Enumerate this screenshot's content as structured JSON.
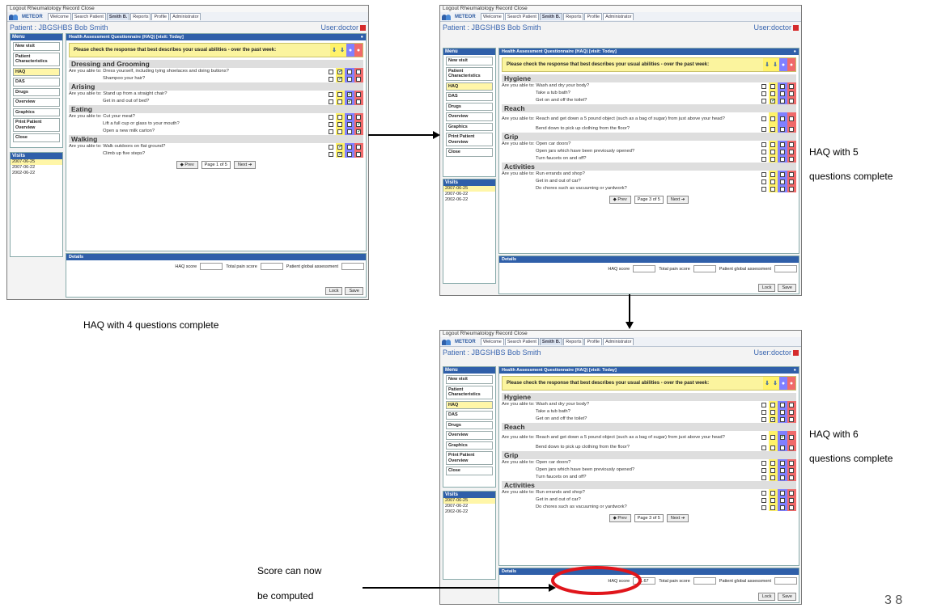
{
  "app": {
    "topbar": "Logout  Rheumatology Record  Close",
    "logo": "METEOR",
    "tabs": [
      "Welcome",
      "Search Patient",
      "Smith B.",
      "Reports",
      "Profile",
      "Administrator"
    ],
    "patient": "Patient : JBGSHBS Bob Smith",
    "user": "User:doctor",
    "menu_header": "Menu",
    "menu_items": [
      "New visit",
      "Patient Characteristics",
      "HAQ",
      "DAS",
      "Drugs",
      "Overview",
      "Graphics",
      "Print Patient Overview",
      "Close"
    ],
    "visits_header": "Visits",
    "visits": [
      "2007-06-25",
      "2007-06-22",
      "2002-06-22"
    ],
    "main_header": "Health Assessment Questionnaire (HAQ) [visit: Today]",
    "instruction": "Please check the response that best describes your usual abilities - over the past week:",
    "details_header": "Details",
    "haq_score_label": "HAQ score",
    "pain_label": "Total pain score",
    "global_label": "Patient global assessment",
    "prev": "Prev",
    "next": "Next",
    "lock": "Lock",
    "save": "Save",
    "colors": {
      "yellow": "#fff26a",
      "purple": "#8080ff",
      "red": "#f06a6a",
      "header": "#2f5fa9"
    }
  },
  "screen1": {
    "page": "Page 1 of 5",
    "haq_score": "",
    "sections": [
      {
        "title": "Dressing and Grooming",
        "questions": [
          {
            "text": "Are you able to: Dress yourself, including tying shoelaces and doing buttons?",
            "checked": 1
          },
          {
            "text": "Shampoo your hair?",
            "checked": 1,
            "sub": true
          }
        ]
      },
      {
        "title": "Arising",
        "questions": [
          {
            "text": "Are you able to: Stand up from a straight chair?",
            "checked": 2
          },
          {
            "text": "Get in and out of bed?",
            "checked": 2,
            "sub": true
          }
        ]
      },
      {
        "title": "Eating",
        "questions": [
          {
            "text": "Are you able to: Cut your meat?",
            "checked": -1
          },
          {
            "text": "Lift a full cup or glass to your mouth?",
            "checked": 3,
            "sub": true
          },
          {
            "text": "Open a new milk carton?",
            "checked": 3,
            "sub": true
          }
        ]
      },
      {
        "title": "Walking",
        "questions": [
          {
            "text": "Are you able to: Walk outdoors on flat ground?",
            "checked": 1
          },
          {
            "text": "Climb up five steps?",
            "checked": 1,
            "sub": true
          }
        ]
      }
    ]
  },
  "screen2": {
    "page": "Page 3 of 5",
    "haq_score": "",
    "sections": [
      {
        "title": "Hygiene",
        "questions": [
          {
            "text": "Are you able to: Wash and dry your body?",
            "checked": -1
          },
          {
            "text": "Take a tub bath?",
            "checked": -1,
            "sub": true
          },
          {
            "text": "Get on and off the toilet?",
            "checked": 1,
            "sub": true
          }
        ]
      },
      {
        "title": "Reach",
        "questions": [
          {
            "text": "Are you able to: Reach and get down a 5 pound object (such as a bag of sugar) from just above your head?",
            "checked": -1,
            "tall": true
          },
          {
            "text": "Bend down to pick up clothing from the floor?",
            "checked": -1,
            "sub": true
          }
        ]
      },
      {
        "title": "Grip",
        "questions": [
          {
            "text": "Are you able to: Open car doors?",
            "checked": -1
          },
          {
            "text": "Open jars which have been previously opened?",
            "checked": -1,
            "sub": true
          },
          {
            "text": "Turn faucets on and off?",
            "checked": -1,
            "sub": true
          }
        ]
      },
      {
        "title": "Activities",
        "questions": [
          {
            "text": "Are you able to: Run errands and shop?",
            "checked": -1
          },
          {
            "text": "Get in and out of car?",
            "checked": -1,
            "sub": true
          },
          {
            "text": "Do chores such as vacuuming or yardwork?",
            "checked": -1,
            "sub": true
          }
        ]
      }
    ]
  },
  "screen3": {
    "page": "Page 3 of 5",
    "haq_score": "1.67",
    "sections": [
      {
        "title": "Hygiene",
        "questions": [
          {
            "text": "Are you able to: Wash and dry your body?",
            "checked": -1
          },
          {
            "text": "Take a tub bath?",
            "checked": -1,
            "sub": true
          },
          {
            "text": "Get on and off the toilet?",
            "checked": 1,
            "sub": true
          }
        ]
      },
      {
        "title": "Reach",
        "questions": [
          {
            "text": "Are you able to: Reach and get down a 5 pound object (such as a bag of sugar) from just above your head?",
            "checked": 2,
            "tall": true
          },
          {
            "text": "Bend down to pick up clothing from the floor?",
            "checked": -1,
            "sub": true
          }
        ]
      },
      {
        "title": "Grip",
        "questions": [
          {
            "text": "Are you able to: Open car doors?",
            "checked": -1
          },
          {
            "text": "Open jars which have been previously opened?",
            "checked": -1,
            "sub": true
          },
          {
            "text": "Turn faucets on and off?",
            "checked": -1,
            "sub": true
          }
        ]
      },
      {
        "title": "Activities",
        "questions": [
          {
            "text": "Are you able to: Run errands and shop?",
            "checked": -1
          },
          {
            "text": "Get in and out of car?",
            "checked": -1,
            "sub": true
          },
          {
            "text": "Do chores such as vacuuming or yardwork?",
            "checked": -1,
            "sub": true
          }
        ]
      }
    ]
  },
  "captions": {
    "c1": "HAQ with 4 questions complete",
    "c2a": "HAQ with 5",
    "c2b": "questions complete",
    "c3a": "HAQ with 6",
    "c3b": "questions complete",
    "c4a": "Score can now",
    "c4b": "be computed",
    "page_num": "3 8"
  }
}
